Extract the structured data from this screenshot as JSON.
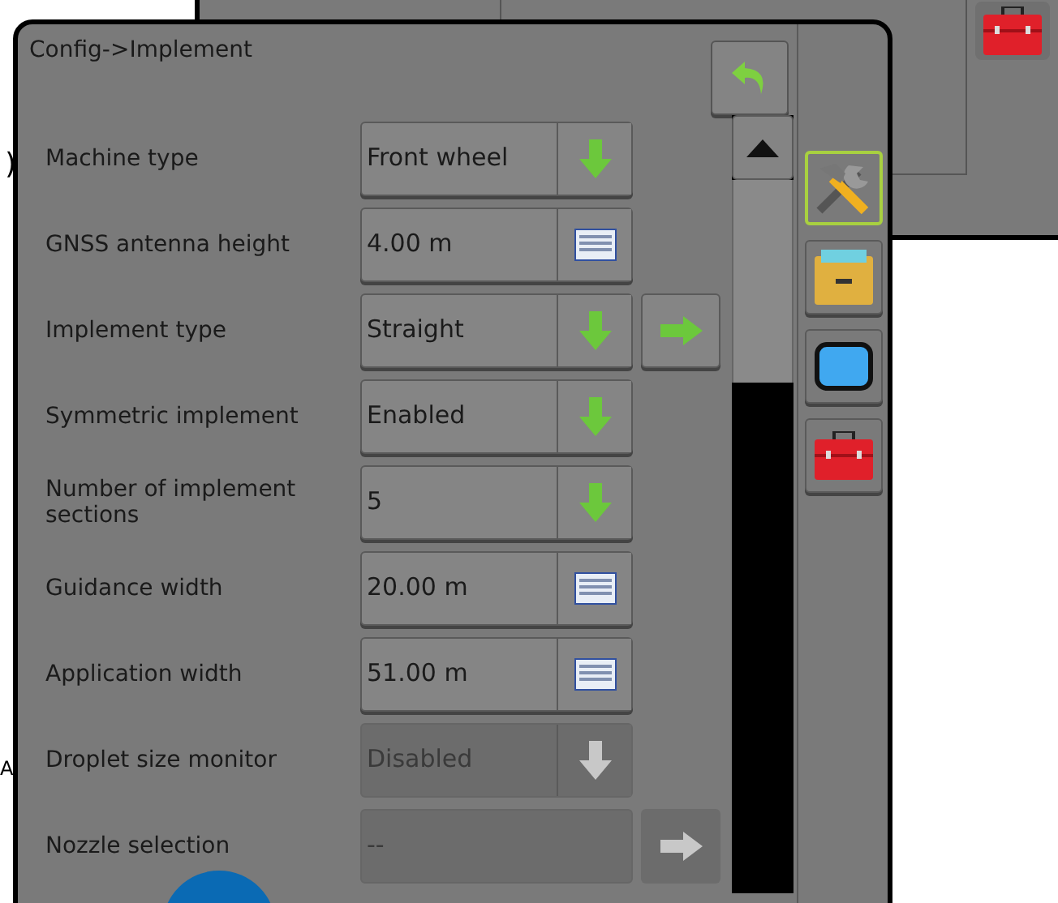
{
  "edge_fragments": [
    ")",
    "A"
  ],
  "window": {
    "title": "Config->Implement"
  },
  "settings": [
    {
      "label": "Machine type",
      "value": "Front wheel",
      "kind": "dropdown",
      "disabled": false,
      "has_next": false
    },
    {
      "label": "GNSS antenna height",
      "value": "4.00 m",
      "kind": "keyboard",
      "disabled": false,
      "has_next": false
    },
    {
      "label": "Implement type",
      "value": "Straight",
      "kind": "dropdown",
      "disabled": false,
      "has_next": true
    },
    {
      "label": "Symmetric implement",
      "value": "Enabled",
      "kind": "dropdown",
      "disabled": false,
      "has_next": false
    },
    {
      "label": "Number of implement sections",
      "value": "5",
      "kind": "dropdown",
      "disabled": false,
      "has_next": false
    },
    {
      "label": "Guidance width",
      "value": "20.00 m",
      "kind": "keyboard",
      "disabled": false,
      "has_next": false
    },
    {
      "label": "Application width",
      "value": "51.00 m",
      "kind": "keyboard",
      "disabled": false,
      "has_next": false
    },
    {
      "label": "Droplet size monitor",
      "value": "Disabled",
      "kind": "dropdown",
      "disabled": true,
      "has_next": false
    },
    {
      "label": "Nozzle selection",
      "value": "--",
      "kind": "none",
      "disabled": true,
      "has_next": true
    }
  ],
  "side_tabs": [
    {
      "kind": "tools",
      "selected": true
    },
    {
      "kind": "drawer",
      "selected": false
    },
    {
      "kind": "screen",
      "selected": false
    },
    {
      "kind": "toolbox",
      "selected": false
    }
  ]
}
